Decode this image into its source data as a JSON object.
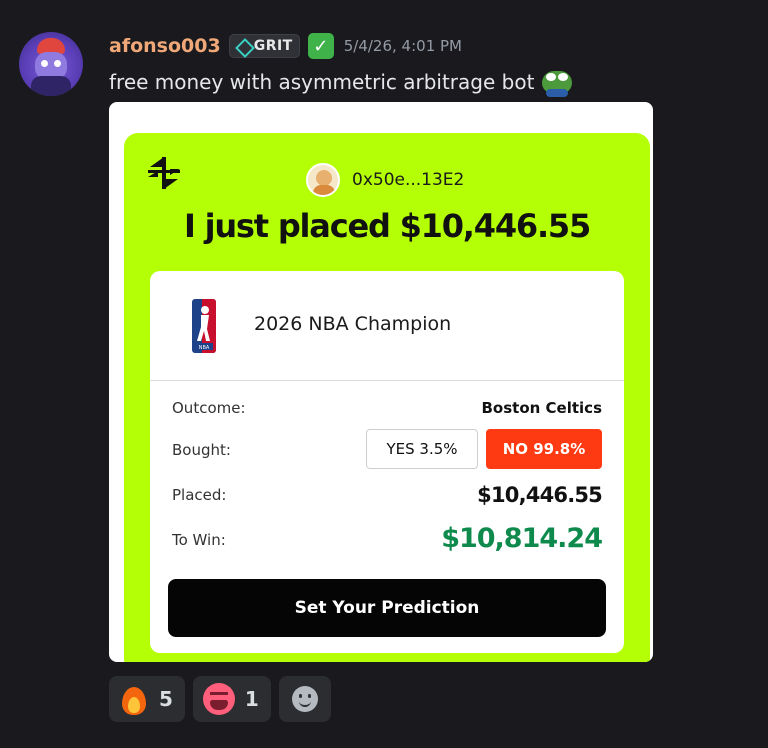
{
  "post": {
    "username": "afonso003",
    "tag_label": "GRIT",
    "timestamp": "5/4/26, 4:01 PM",
    "message": "free money with asymmetric arbitrage bot"
  },
  "card": {
    "wallet_address": "0x50e...13E2",
    "headline": "I just placed $10,446.55",
    "market_title": "2026 NBA Champion",
    "outcome_label": "Outcome:",
    "outcome_value": "Boston Celtics",
    "bought_label": "Bought:",
    "yes_pill": "YES 3.5%",
    "no_pill": "NO 99.8%",
    "placed_label": "Placed:",
    "placed_value": "$10,446.55",
    "towin_label": "To Win:",
    "towin_value": "$10,814.24",
    "cta_label": "Set Your Prediction",
    "colors": {
      "accent": "#b4ff05",
      "no": "#fd3a12",
      "win": "#0f8a4d"
    }
  },
  "reactions": [
    {
      "emoji": "fire-icon",
      "count": "5"
    },
    {
      "emoji": "hot-face-icon",
      "count": "1"
    }
  ]
}
